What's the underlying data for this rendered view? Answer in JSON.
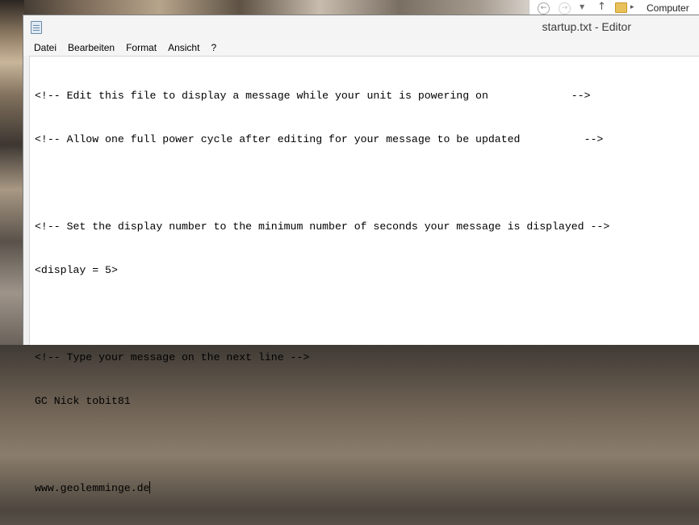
{
  "explorer": {
    "breadcrumb": "Computer"
  },
  "window": {
    "title": "startup.txt - Editor"
  },
  "menu": {
    "items": [
      "Datei",
      "Bearbeiten",
      "Format",
      "Ansicht",
      "?"
    ]
  },
  "document": {
    "lines": [
      "<!-- Edit this file to display a message while your unit is powering on             -->",
      "<!-- Allow one full power cycle after editing for your message to be updated          -->",
      "",
      "<!-- Set the display number to the minimum number of seconds your message is displayed -->",
      "<display = 5>",
      "",
      "<!-- Type your message on the next line -->",
      "GC Nick tobit81",
      "",
      "www.geolemminge.de"
    ]
  }
}
